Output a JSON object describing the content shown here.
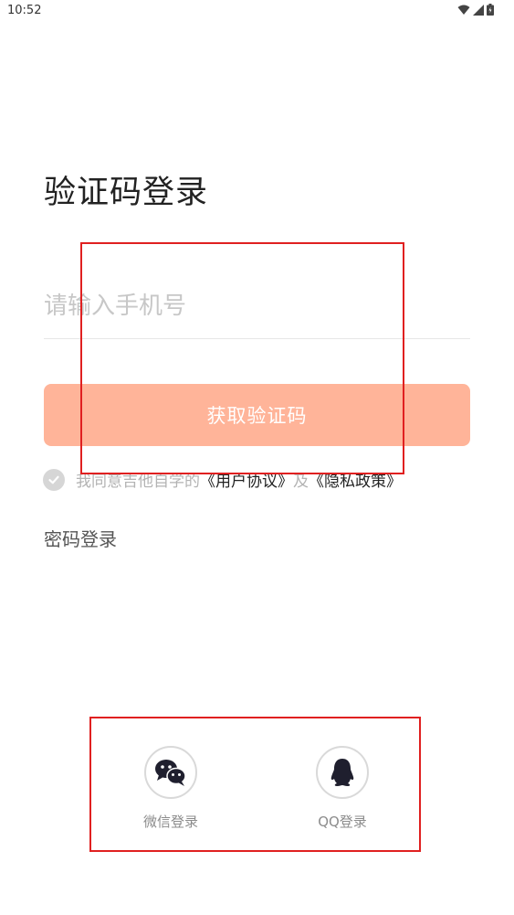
{
  "status_bar": {
    "time": "10:52"
  },
  "page": {
    "title": "验证码登录"
  },
  "phone": {
    "placeholder": "请输入手机号",
    "value": ""
  },
  "get_code_button": {
    "label": "获取验证码"
  },
  "agreement": {
    "prefix": "我同意吉他自学的",
    "user_agreement": "《用户协议》",
    "and": "及",
    "privacy_policy": "《隐私政策》",
    "checked": true
  },
  "password_login": {
    "label": "密码登录"
  },
  "social_login": {
    "wechat": {
      "label": "微信登录",
      "icon": "wechat-icon"
    },
    "qq": {
      "label": "QQ登录",
      "icon": "qq-icon"
    }
  },
  "colors": {
    "button": "#ffb499",
    "highlight": "#e02020",
    "placeholder": "#c7c7c7",
    "icon": "#1f1f2e"
  }
}
